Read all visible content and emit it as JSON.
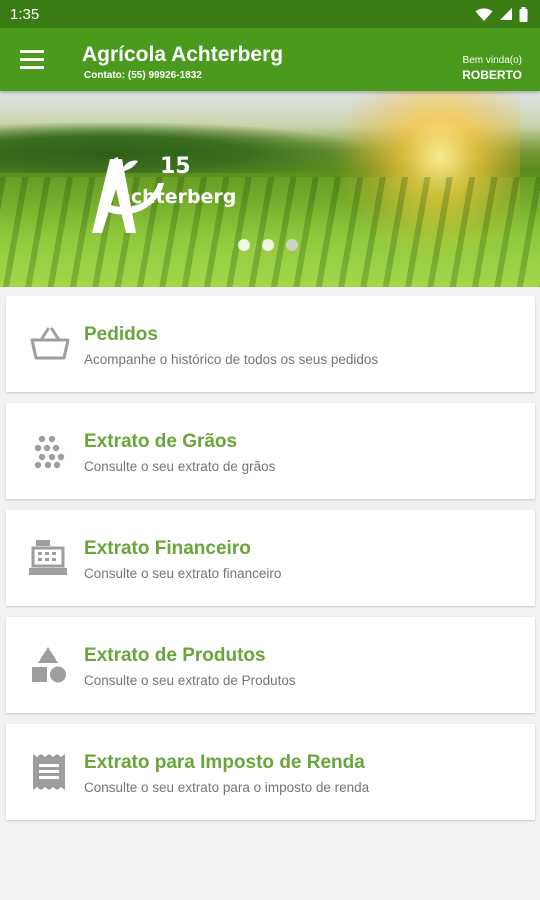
{
  "status_bar": {
    "time": "1:35",
    "icons": [
      "wifi-icon",
      "signal-icon",
      "battery-icon"
    ]
  },
  "header": {
    "title": "Agrícola Achterberg",
    "contact": "Contato: (55) 99926-1832",
    "welcome": "Bem vinda(o)",
    "user": "ROBERTO",
    "menu_icon": "hamburger-menu-icon",
    "color": "#4a9a1e"
  },
  "banner": {
    "logo_text": "achterberg",
    "logo_number": "15",
    "slides": 3,
    "active_slide": 1
  },
  "menu": [
    {
      "title": "Pedidos",
      "subtitle": "Acompanhe o histórico de todos os seus pedidos",
      "icon": "basket-icon"
    },
    {
      "title": "Extrato de Grãos",
      "subtitle": "Consulte o seu extrato de grãos",
      "icon": "grains-icon"
    },
    {
      "title": "Extrato Financeiro",
      "subtitle": "Consulte o seu extrato financeiro",
      "icon": "cash-register-icon"
    },
    {
      "title": "Extrato de Produtos",
      "subtitle": "Consulte o seu extrato de Produtos",
      "icon": "shapes-icon"
    },
    {
      "title": "Extrato para Imposto de Renda",
      "subtitle": "Consulte o seu extrato para o imposto de renda",
      "icon": "receipt-icon"
    }
  ],
  "colors": {
    "accent": "#6aa43a",
    "status_bar": "#3a7d15",
    "icon": "#9e9e9e"
  }
}
